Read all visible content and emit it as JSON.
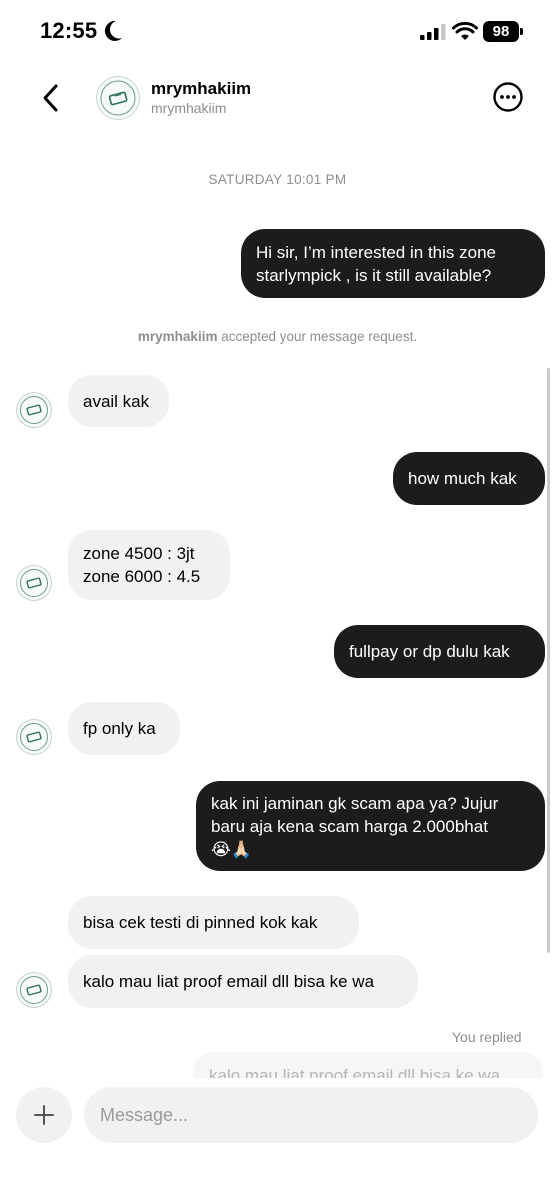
{
  "status_bar": {
    "time": "12:55",
    "battery": "98"
  },
  "header": {
    "username": "mrymhakiim",
    "handle": "mrymhakiim"
  },
  "date_divider": "SATURDAY 10:01 PM",
  "system_message": {
    "username": "mrymhakiim",
    "text": " accepted your message request."
  },
  "messages": [
    {
      "from": "me",
      "lines": [
        "Hi sir, I’m interested in this zone",
        "starlympick , is it still available?"
      ]
    },
    {
      "from": "them",
      "lines": [
        "avail kak"
      ]
    },
    {
      "from": "me",
      "lines": [
        "how much kak"
      ]
    },
    {
      "from": "them",
      "lines": [
        "zone 4500 : 3jt",
        "zone 6000 : 4.5"
      ]
    },
    {
      "from": "me",
      "lines": [
        "fullpay or dp dulu kak"
      ]
    },
    {
      "from": "them",
      "lines": [
        "fp only ka"
      ]
    },
    {
      "from": "me",
      "lines": [
        "kak ini jaminan gk scam apa ya? Jujur",
        "baru aja kena scam harga 2.000bhat",
        "😭🙏🏻"
      ]
    },
    {
      "from": "them",
      "lines": [
        "bisa cek testi di pinned kok kak"
      ]
    },
    {
      "from": "them",
      "lines": [
        "kalo mau liat proof email dll bisa ke wa"
      ]
    }
  ],
  "reply": {
    "label": "You replied",
    "preview": "kalo mau liat proof email dll bisa ke wa"
  },
  "composer": {
    "placeholder": "Message..."
  },
  "icons": {
    "back": "chevron-left-icon",
    "more": "more-options-icon",
    "add": "plus-icon"
  }
}
